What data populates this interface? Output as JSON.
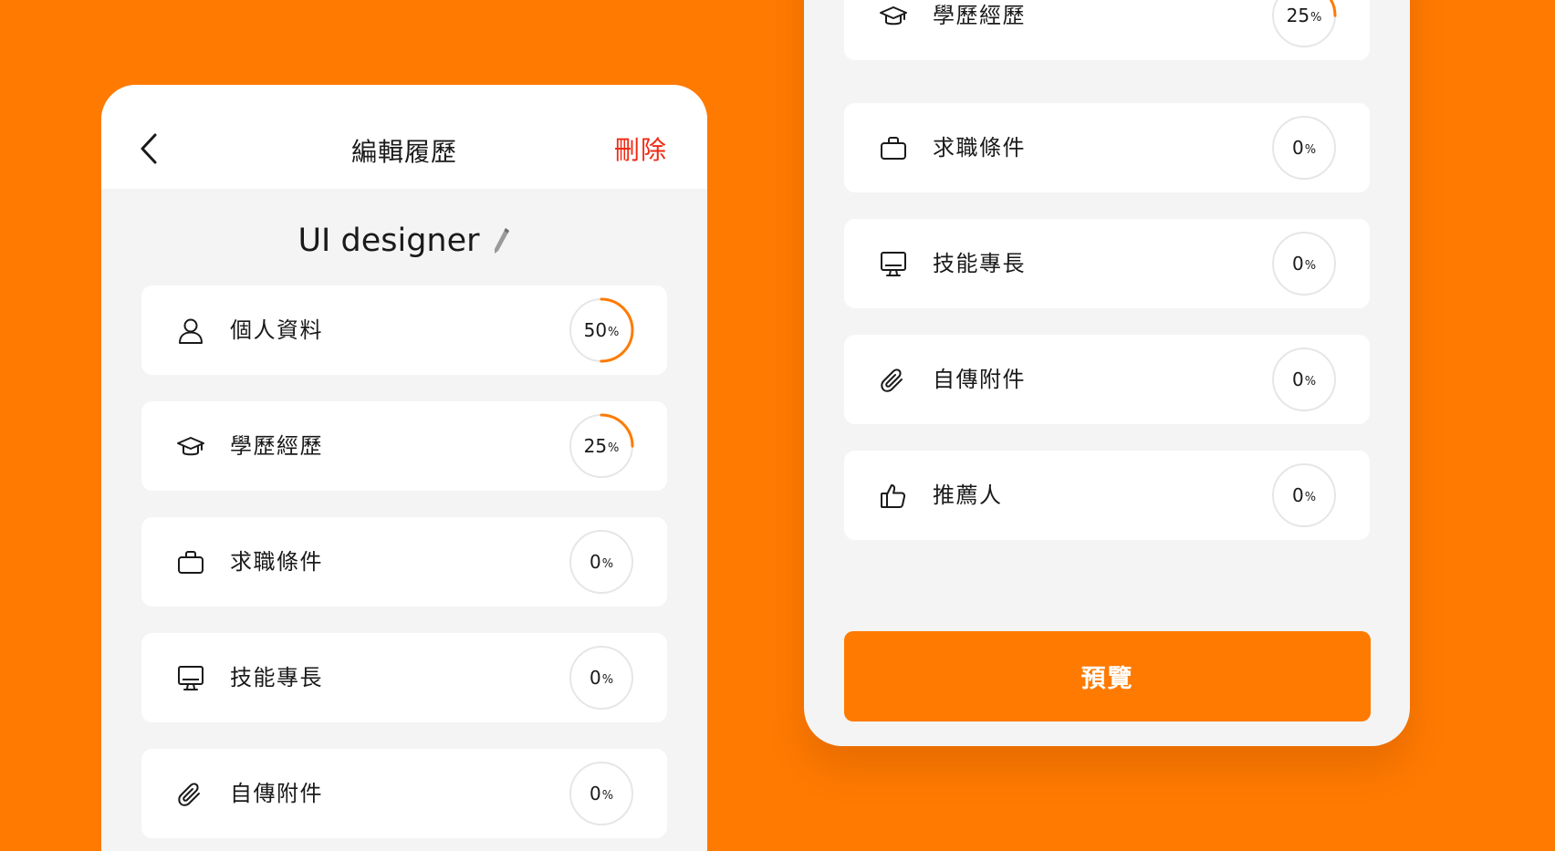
{
  "theme": {
    "accent": "#FF7A00",
    "delete_color": "#F02A14",
    "ring_track": "#E6E6E6"
  },
  "left_screen": {
    "nav": {
      "back_icon": "chevron-left-icon",
      "title": "編輯履歷",
      "delete_label": "刪除"
    },
    "resume_name": "UI designer",
    "edit_icon": "pencil-icon",
    "sections": [
      {
        "id": "profile",
        "icon": "user-icon",
        "label": "個人資料",
        "progress": 50,
        "unit": "%"
      },
      {
        "id": "education",
        "icon": "graduation-cap-icon",
        "label": "學歷經歷",
        "progress": 25,
        "unit": "%"
      },
      {
        "id": "job-conditions",
        "icon": "briefcase-icon",
        "label": "求職條件",
        "progress": 0,
        "unit": "%"
      },
      {
        "id": "skills",
        "icon": "monitor-icon",
        "label": "技能專長",
        "progress": 0,
        "unit": "%"
      },
      {
        "id": "attachments",
        "icon": "paperclip-icon",
        "label": "自傳附件",
        "progress": 0,
        "unit": "%"
      }
    ]
  },
  "right_screen": {
    "sections": [
      {
        "id": "education",
        "icon": "graduation-cap-icon",
        "label": "學歷經歷",
        "progress": 25,
        "unit": "%"
      },
      {
        "id": "job-conditions",
        "icon": "briefcase-icon",
        "label": "求職條件",
        "progress": 0,
        "unit": "%"
      },
      {
        "id": "skills",
        "icon": "monitor-icon",
        "label": "技能專長",
        "progress": 0,
        "unit": "%"
      },
      {
        "id": "attachments",
        "icon": "paperclip-icon",
        "label": "自傳附件",
        "progress": 0,
        "unit": "%"
      },
      {
        "id": "references",
        "icon": "thumbs-up-icon",
        "label": "推薦人",
        "progress": 0,
        "unit": "%"
      }
    ],
    "preview_label": "預覽"
  }
}
